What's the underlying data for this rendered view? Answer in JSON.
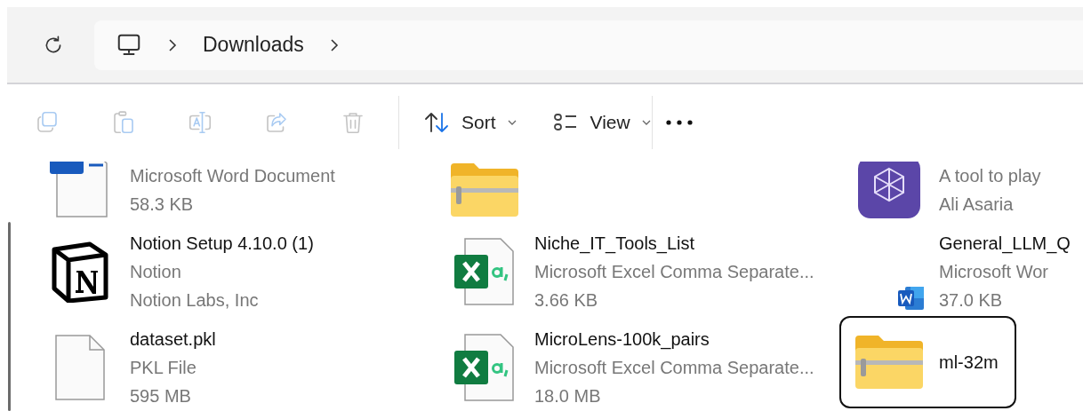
{
  "address_bar": {
    "breadcrumb": [
      {
        "label": "Downloads"
      }
    ]
  },
  "toolbar": {
    "actions": [
      {
        "kind": "copy",
        "disabled": true
      },
      {
        "kind": "paste",
        "disabled": true
      },
      {
        "kind": "rename",
        "disabled": true
      },
      {
        "kind": "share",
        "disabled": true
      },
      {
        "kind": "delete",
        "disabled": true
      }
    ],
    "sort": {
      "label": "Sort"
    },
    "view": {
      "label": "View"
    }
  },
  "rows": [
    [
      {
        "kind": "word",
        "lines": [
          "Microsoft Word Document",
          "58.3 KB"
        ],
        "selected": false
      },
      {
        "kind": "zip",
        "selected": false
      },
      {
        "kind": "app",
        "lines": [
          "A tool to play",
          "Ali Asaria"
        ],
        "selected": false
      }
    ],
    [
      {
        "kind": "notion",
        "name": "Notion Setup 4.10.0 (1)",
        "lines": [
          "Notion",
          "Notion Labs, Inc"
        ],
        "selected": false
      },
      {
        "kind": "csv",
        "name": "Niche_IT_Tools_List",
        "lines": [
          "Microsoft Excel Comma Separate...",
          "3.66 KB"
        ],
        "selected": false
      },
      {
        "kind": "shortcut",
        "name": "General_LLM_Q",
        "lines": [
          "Microsoft Wor",
          "37.0 KB"
        ],
        "selected": false
      }
    ],
    [
      {
        "kind": "blank",
        "name": "dataset.pkl",
        "lines": [
          "PKL File",
          "595 MB"
        ],
        "selected": false
      },
      {
        "kind": "csv",
        "name": "MicroLens-100k_pairs",
        "lines": [
          "Microsoft Excel Comma Separate...",
          "18.0 MB"
        ],
        "selected": false
      },
      {
        "kind": "zip",
        "name": "ml-32m",
        "selected": true
      }
    ]
  ]
}
